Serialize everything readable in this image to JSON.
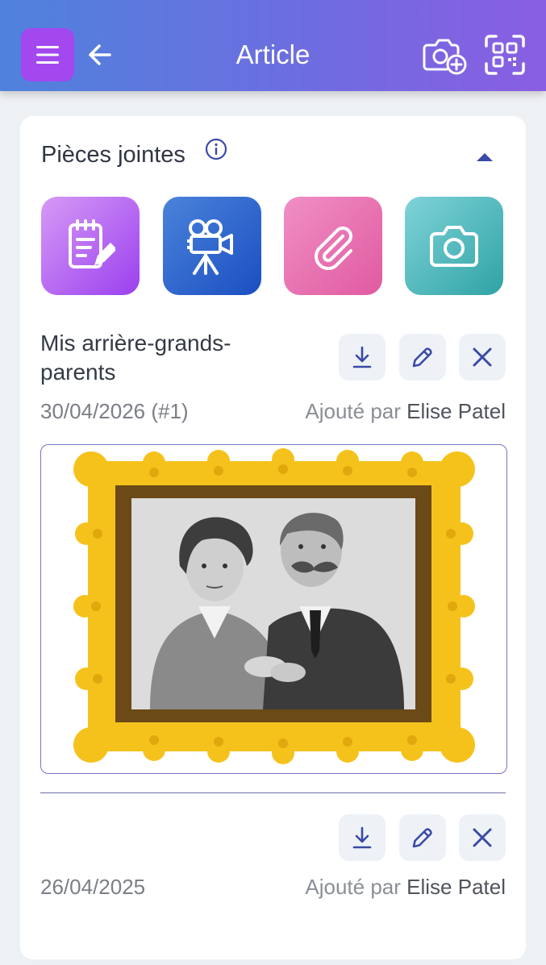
{
  "header": {
    "title": "Article"
  },
  "section": {
    "title": "Pièces jointes"
  },
  "attachments": [
    {
      "name": "Mis arrière-grands-parents",
      "date": "30/04/2026 (#1)",
      "added_prefix": "Ajouté par",
      "added_by": "Elise Patel"
    },
    {
      "name": "",
      "date": "26/04/2025",
      "added_prefix": "Ajouté par",
      "added_by": "Elise Patel"
    }
  ],
  "icons": {
    "menu": "menu-icon",
    "back": "arrow-left-icon",
    "camera_add": "camera-plus-icon",
    "scan": "qr-scan-icon",
    "info": "info-icon",
    "collapse": "chevron-up-icon",
    "note": "note-icon",
    "video": "video-camera-icon",
    "attach": "paperclip-icon",
    "photo": "camera-icon",
    "download": "download-icon",
    "edit": "pencil-icon",
    "delete": "close-icon"
  },
  "colors": {
    "header_start": "#4f82dc",
    "header_end": "#8a5ee2",
    "menu_button": "#a248ee",
    "action_icon": "#3a4aa6",
    "note_tile": "#b66cf2",
    "video_tile": "#2f68cf",
    "attach_tile": "#e874b2",
    "photo_tile": "#4cbcc0"
  }
}
